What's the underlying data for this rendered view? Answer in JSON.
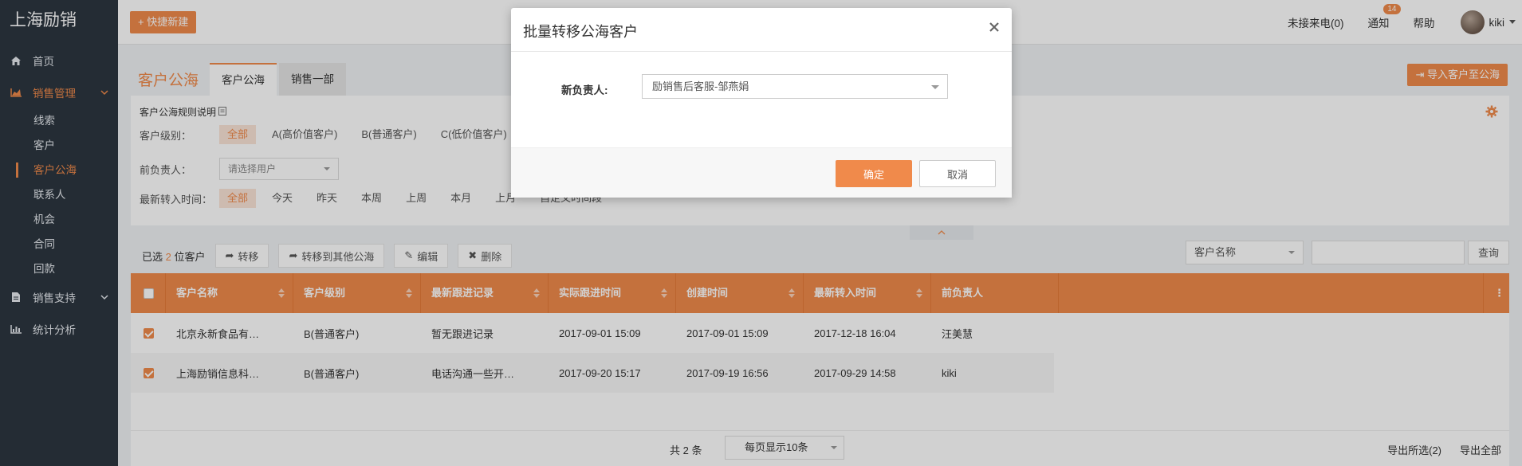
{
  "brand": {
    "logo_text": "上海励销",
    "accent": "#f08a4b",
    "sidebar_bg": "#2c3640"
  },
  "sidebar": {
    "items": [
      {
        "label": "首页",
        "icon": "home-icon"
      },
      {
        "label": "销售管理",
        "icon": "area-chart-icon",
        "expanded": true
      },
      {
        "label": "销售支持",
        "icon": "file-icon"
      },
      {
        "label": "统计分析",
        "icon": "bar-chart-icon"
      }
    ],
    "sub_items": [
      "线索",
      "客户",
      "客户公海",
      "联系人",
      "机会",
      "合同",
      "回款"
    ],
    "active_sub": "客户公海"
  },
  "topbar": {
    "quick_create": "+ 快捷新建",
    "missed_calls": "未接来电(0)",
    "notify": "通知",
    "notify_count": "14",
    "help": "帮助",
    "user": "kiki"
  },
  "page": {
    "title": "客户公海",
    "tabs": [
      "客户公海",
      "销售一部"
    ],
    "import_button": "导入客户至公海"
  },
  "filters": {
    "rule_link": "客户公海规则说明",
    "level_label": "客户级别：",
    "level_options": [
      "全部",
      "A(高价值客户)",
      "B(普通客户)",
      "C(低价值客户)"
    ],
    "owner_label": "前负责人：",
    "owner_placeholder": "请选择用户",
    "time_label": "最新转入时间：",
    "time_options": [
      "全部",
      "今天",
      "昨天",
      "本周",
      "上周",
      "本月",
      "上月",
      "自定义时间段"
    ]
  },
  "toolbar": {
    "selected_prefix": "已选",
    "selected_count": "2",
    "selected_suffix": "位客户",
    "transfer": "转移",
    "transfer_other": "转移到其他公海",
    "edit": "编辑",
    "delete": "删除",
    "search_field": "客户名称",
    "search_value": "",
    "search_button": "查询"
  },
  "table": {
    "columns": [
      "客户名称",
      "客户级别",
      "最新跟进记录",
      "实际跟进时间",
      "创建时间",
      "最新转入时间",
      "前负责人"
    ],
    "rows": [
      {
        "checked": true,
        "name": "北京永新食品有…",
        "level": "B(普通客户)",
        "followup": "暂无跟进记录",
        "actual_time": "2017-09-01 15:09",
        "created": "2017-09-01 15:09",
        "latest_in": "2017-12-18 16:04",
        "prev_owner": "汪美慧"
      },
      {
        "checked": true,
        "name": "上海励销信息科…",
        "level": "B(普通客户)",
        "followup": "电话沟通一些开…",
        "actual_time": "2017-09-20 15:17",
        "created": "2017-09-19 16:56",
        "latest_in": "2017-09-29 14:58",
        "prev_owner": "kiki"
      }
    ]
  },
  "pager": {
    "total": "共 2 条",
    "per_page": "每页显示10条",
    "export_selected": "导出所选(2)",
    "export_all": "导出全部"
  },
  "modal": {
    "title": "批量转移公海客户",
    "field_label": "新负责人:",
    "field_value": "励销售后客服-邹燕娟",
    "ok": "确定",
    "cancel": "取消"
  }
}
